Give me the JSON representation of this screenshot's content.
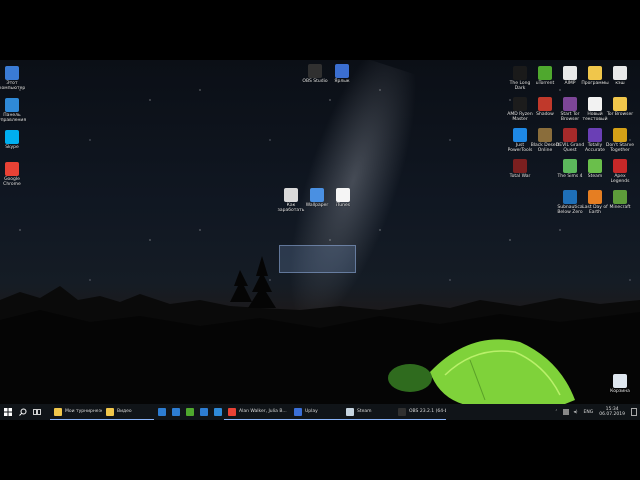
{
  "desktop": {
    "left_icons": [
      {
        "label": "Этот компьютер",
        "icon": "computer-icon",
        "color": "#3a7bd5"
      },
      {
        "label": "Панель управления",
        "icon": "control-panel-icon",
        "color": "#2f8ad8"
      },
      {
        "label": "Skype",
        "icon": "skype-icon",
        "color": "#00aff0"
      },
      {
        "label": "Google Chrome",
        "icon": "chrome-icon",
        "color": "#e94235"
      }
    ],
    "top_icons": [
      {
        "label": "OBS Studio",
        "icon": "obs-icon",
        "color": "#303030"
      },
      {
        "label": "Ярлык",
        "icon": "shortcut-icon",
        "color": "#3b6fd1"
      }
    ],
    "selected_icons": [
      {
        "label": "Как заработать",
        "icon": "document-icon",
        "color": "#d9d9d9"
      },
      {
        "label": "Wallpaper",
        "icon": "image-icon",
        "color": "#4a90e2"
      },
      {
        "label": "iTunes",
        "icon": "itunes-icon",
        "color": "#f5f5f5"
      }
    ],
    "right_icons": [
      [
        {
          "label": "The Long Dark",
          "icon": "game-icon",
          "color": "#1a1a1a"
        },
        {
          "label": "uTorrent",
          "icon": "torrent-icon",
          "color": "#4fa82e"
        },
        {
          "label": "AIMP",
          "icon": "music-icon",
          "color": "#e8e8e8"
        },
        {
          "label": "Программы",
          "icon": "folder-icon",
          "color": "#f0c64b"
        },
        {
          "label": "кэш",
          "icon": "file-icon",
          "color": "#e8e8e8"
        }
      ],
      [
        {
          "label": "AMD Ryzen Master",
          "icon": "amd-icon",
          "color": "#1c1c1c"
        },
        {
          "label": "Shadow",
          "icon": "app-icon",
          "color": "#c0392b"
        },
        {
          "label": "Start Tor Browser",
          "icon": "tor-icon",
          "color": "#7d4698"
        },
        {
          "label": "Новый текстовый",
          "icon": "text-file-icon",
          "color": "#f2f2f2"
        },
        {
          "label": "Tor Browser",
          "icon": "tor-folder-icon",
          "color": "#f0c64b"
        }
      ],
      [
        {
          "label": "Just PowerTools",
          "icon": "tools-icon",
          "color": "#1e88e5"
        },
        {
          "label": "Black Desert Online",
          "icon": "bdo-icon",
          "color": "#8a6d3b"
        },
        {
          "label": "DEVIL Grand Quest",
          "icon": "devil-icon",
          "color": "#a52a2a"
        },
        {
          "label": "Totally Accurate",
          "icon": "tabs-icon",
          "color": "#6a3fb5"
        },
        {
          "label": "Don't Starve Together",
          "icon": "dst-icon",
          "color": "#d4a017"
        }
      ],
      [
        {
          "label": "Total War",
          "icon": "totalwar-icon",
          "color": "#7a1f1f"
        },
        {
          "label": "",
          "icon": "",
          "color": ""
        },
        {
          "label": "The Sims 4",
          "icon": "sims-icon",
          "color": "#5cb85c"
        },
        {
          "label": "Steam",
          "icon": "steam-icon",
          "color": "#6abf4b"
        },
        {
          "label": "Apex Legends",
          "icon": "apex-icon",
          "color": "#c62828"
        }
      ],
      [
        {
          "label": "",
          "icon": "",
          "color": ""
        },
        {
          "label": "",
          "icon": "",
          "color": ""
        },
        {
          "label": "Subnautica Below Zero",
          "icon": "subnautica-icon",
          "color": "#1e6fb8"
        },
        {
          "label": "Last Day of Earth",
          "icon": "ldoe-icon",
          "color": "#e67e22"
        },
        {
          "label": "Minecraft",
          "icon": "minecraft-icon",
          "color": "#5d9c3a"
        }
      ]
    ],
    "recycle_bin": {
      "label": "Корзина",
      "icon": "recycle-bin-icon",
      "color": "#dfe7ef"
    }
  },
  "taskbar": {
    "start_icon": "windows-start-icon",
    "search_icon": "search-icon",
    "taskview_icon": "task-view-icon",
    "items": [
      {
        "label": "Мои турнирнезе",
        "icon": "explorer-icon",
        "color": "#f0c64b",
        "width": 52
      },
      {
        "label": "Видео",
        "icon": "explorer-icon",
        "color": "#f0c64b",
        "width": 52
      },
      {
        "label": "",
        "icon": "edge-icon",
        "color": "#2d7dd2",
        "width": 14
      },
      {
        "label": "",
        "icon": "store-icon",
        "color": "#2d7dd2",
        "width": 14
      },
      {
        "label": "",
        "icon": "utorrent-icon",
        "color": "#4fa82e",
        "width": 14
      },
      {
        "label": "",
        "icon": "app-icon",
        "color": "#2d7dd2",
        "width": 14
      },
      {
        "label": "",
        "icon": "chrome-icon",
        "color": "#2f8ad8",
        "width": 14
      },
      {
        "label": "Alan Walker, Julia B...",
        "icon": "chrome-icon",
        "color": "#e94235",
        "width": 66
      },
      {
        "label": "Uplay",
        "icon": "uplay-icon",
        "color": "#3a6fd8",
        "width": 52
      },
      {
        "label": "Steam",
        "icon": "steam-icon",
        "color": "#c6d4df",
        "width": 52
      },
      {
        "label": "OBS 23.2.1 (64-bit, ...",
        "icon": "obs-icon",
        "color": "#303030",
        "width": 52
      }
    ],
    "tray": {
      "language": "ENG",
      "time": "15:34",
      "date": "06.07.2019"
    }
  }
}
